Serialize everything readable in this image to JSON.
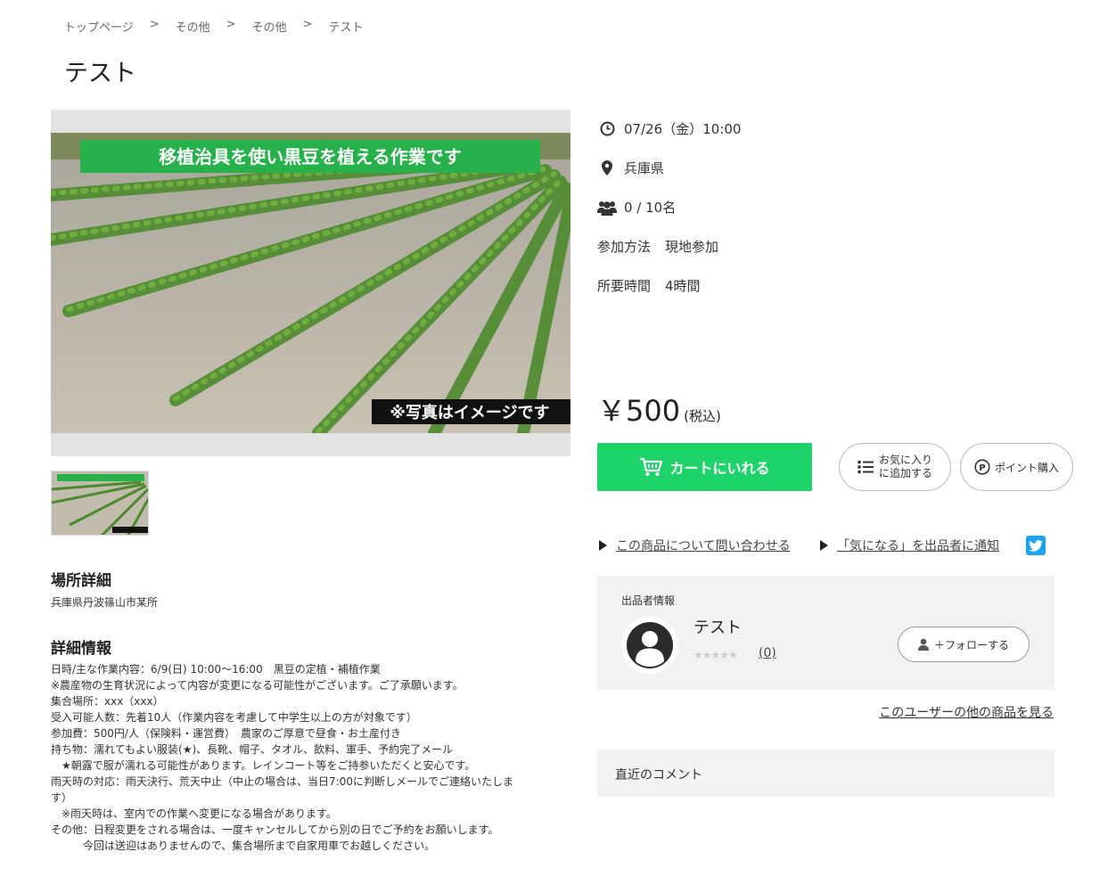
{
  "breadcrumb": [
    "トップページ",
    "その他",
    "その他",
    "テスト"
  ],
  "breadcrumb_sep": ">",
  "title": "テスト",
  "image": {
    "banner_text": "移植治具を使い黒豆を植える作業です",
    "caption_text": "※写真はイメージです"
  },
  "place_heading": "場所詳細",
  "place_text": "兵庫県丹波篠山市某所",
  "detail_heading": "詳細情報",
  "detail_lines": [
    "日時/主な作業内容：6/9(日) 10:00〜16:00　黒豆の定植・補植作業",
    "※農産物の生育状況によって内容が変更になる可能性がございます。ご了承願います。",
    "集合場所：xxx（xxx）",
    "受入可能人数：先着10人（作業内容を考慮して中学生以上の方が対象です）",
    "参加費：500円/人（保険料・運営費）　農家のご厚意で昼食・お土産付き",
    "持ち物：濡れてもよい服装(★)、長靴、帽子、タオル、飲料、軍手、予約完了メール",
    "　★朝露で服が濡れる可能性があります。レインコート等をご持参いただくと安心です。",
    "雨天時の対応：雨天決行、荒天中止（中止の場合は、当日7:00に判断しメールでご連絡いたしま",
    "す）",
    "　※雨天時は、室内での作業へ変更になる場合があります。",
    "その他：日程変更をされる場合は、一度キャンセルしてから別の日でご予約をお願いします。",
    "　　　今回は送迎はありませんので、集合場所まで自家用車でお越しください。"
  ],
  "info": {
    "datetime": "07/26（金）10:00",
    "location": "兵庫県",
    "capacity": "0 / 10名",
    "method_label": "参加方法",
    "method_value": "現地参加",
    "duration_label": "所要時間",
    "duration_value": "4時間"
  },
  "price": {
    "amount": "￥500",
    "tax": "(税込)"
  },
  "buttons": {
    "cart": "カートにいれる",
    "favorite_line1": "お気に入り",
    "favorite_line2": "に追加する",
    "point": "ポイント購入"
  },
  "links": {
    "inquiry": "この商品について問い合わせる",
    "notify": "「気になる」を出品者に通知"
  },
  "seller": {
    "label": "出品者情報",
    "name": "テスト",
    "review_count": "(0)",
    "rating": 0,
    "follow": "＋フォローする"
  },
  "other_items": "このユーザーの他の商品を見る",
  "comments_heading": "直近のコメント",
  "colors": {
    "accent": "#1fd36b",
    "twitter": "#1da1f2",
    "panel": "#f2f2f2"
  }
}
